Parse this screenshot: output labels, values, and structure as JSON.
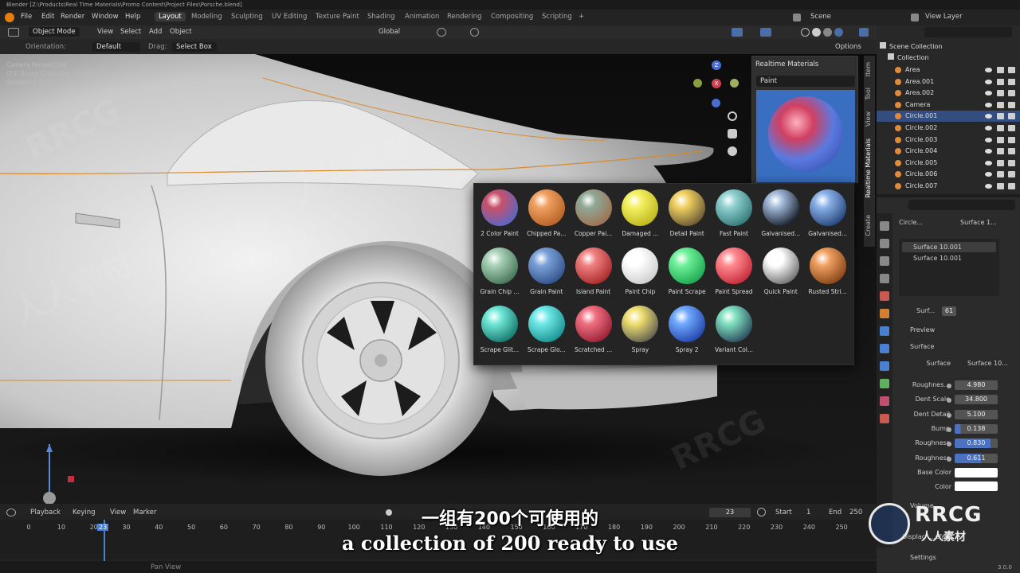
{
  "title": "Blender [Z:\\Products\\Real Time Materials\\Promo Content\\Project Files\\Porsche.blend]",
  "menus": [
    "File",
    "Edit",
    "Render",
    "Window",
    "Help"
  ],
  "workspaces": [
    "Layout",
    "Modeling",
    "Sculpting",
    "UV Editing",
    "Texture Paint",
    "Shading",
    "Animation",
    "Rendering",
    "Compositing",
    "Scripting"
  ],
  "scene": "Scene",
  "view_layer": "View Layer",
  "header": {
    "mode": "Object Mode",
    "menus": [
      "View",
      "Select",
      "Add",
      "Object"
    ],
    "transform": "Global",
    "orientation_label": "Orientation:",
    "orientation": "Default",
    "drag_label": "Drag:",
    "drag": "Select Box",
    "options": "Options"
  },
  "viewport": {
    "overlay1": "Camera Perspective",
    "overlay2": "(23) Scene Collection | Circle.001",
    "overlay3": "Rendering Done"
  },
  "rm_panel": {
    "title": "Realtime Materials",
    "category": "Paint"
  },
  "side_tabs": [
    "Item",
    "Tool",
    "View",
    "Realtime Materials",
    "Create"
  ],
  "materials": [
    {
      "label": "2 Color Paint",
      "c1": "#c9506a",
      "c2": "#4a6ad0"
    },
    {
      "label": "Chipped Pa...",
      "c1": "#f0a060",
      "c2": "#b05a20"
    },
    {
      "label": "Copper Pai...",
      "c1": "#8fa896",
      "c2": "#a06a4a"
    },
    {
      "label": "Damaged ...",
      "c1": "#f4f060",
      "c2": "#b8b018"
    },
    {
      "label": "Detail Paint",
      "c1": "#f0d060",
      "c2": "#5a4a30"
    },
    {
      "label": "Fast Paint",
      "c1": "#8fd0d0",
      "c2": "#2a7070"
    },
    {
      "label": "Galvanised...",
      "c1": "#a0b8d8",
      "c2": "#0a0f1a"
    },
    {
      "label": "Galvanised...",
      "c1": "#8ab0e8",
      "c2": "#1a3a70"
    },
    {
      "label": "Grain Chip ...",
      "c1": "#a8d0b8",
      "c2": "#3a6a4a"
    },
    {
      "label": "Grain Paint",
      "c1": "#7aa0d8",
      "c2": "#2a4a80"
    },
    {
      "label": "Island Paint",
      "c1": "#f08080",
      "c2": "#a02020"
    },
    {
      "label": "Paint Chip",
      "c1": "#ffffff",
      "c2": "#c8c8c8"
    },
    {
      "label": "Paint Scrape",
      "c1": "#6ff09a",
      "c2": "#14a048"
    },
    {
      "label": "Paint Spread",
      "c1": "#ff8a90",
      "c2": "#c02030"
    },
    {
      "label": "Quick Paint",
      "c1": "#ffffff",
      "c2": "#606060"
    },
    {
      "label": "Rusted Stri...",
      "c1": "#f0a060",
      "c2": "#7a3a10"
    },
    {
      "label": "Scrape Glit...",
      "c1": "#70e8d8",
      "c2": "#0a6a60"
    },
    {
      "label": "Scrape Glo...",
      "c1": "#70e8e8",
      "c2": "#108888"
    },
    {
      "label": "Scratched ...",
      "c1": "#f07080",
      "c2": "#901830"
    },
    {
      "label": "Spray",
      "c1": "#f0e070",
      "c2": "#505050"
    },
    {
      "label": "Spray 2",
      "c1": "#70a8ff",
      "c2": "#1a3aa0"
    },
    {
      "label": "Variant Col...",
      "c1": "#80e0c0",
      "c2": "#203a50"
    }
  ],
  "outliner": {
    "scene_collection": "Scene Collection",
    "collection": "Collection",
    "items": [
      "Area",
      "Area.001",
      "Area.002",
      "Camera",
      "Circle.001",
      "Circle.002",
      "Circle.003",
      "Circle.004",
      "Circle.005",
      "Circle.006",
      "Circle.007"
    ],
    "selected_index": 4
  },
  "properties": {
    "breadcrumb_obj": "Circle...",
    "breadcrumb_mat": "Surface 1...",
    "slots": [
      "Surface 10.001",
      "Surface 10.001"
    ],
    "mat_name": "Surf...",
    "mat_users": "61",
    "preview": "Preview",
    "surface_section": "Surface",
    "surface_label": "Surface",
    "surface_value": "Surface 10...",
    "fields": [
      {
        "label": "Roughnes...",
        "value": "4.980"
      },
      {
        "label": "Dent Scale",
        "value": "34.800"
      },
      {
        "label": "Dent Detail",
        "value": "5.100"
      },
      {
        "label": "Bump",
        "value": "0.138",
        "fill": 0.14
      },
      {
        "label": "Roughness",
        "value": "0.830",
        "fill": 0.83
      },
      {
        "label": "Roughness",
        "value": "0.611",
        "fill": 0.61
      }
    ],
    "base_color_label": "Base Color",
    "color_label": "Color",
    "volume": "Volume",
    "displacement_label": "Displac",
    "displacement_value": "...efa...",
    "settings": "Settings"
  },
  "timeline": {
    "menus": [
      "Playback",
      "Keying",
      "View",
      "Marker"
    ],
    "current_frame": "23",
    "start_label": "Start",
    "start": "1",
    "end_label": "End",
    "end": "250",
    "ticks": [
      "0",
      "10",
      "20",
      "30",
      "40",
      "50",
      "60",
      "70",
      "80",
      "90",
      "100",
      "110",
      "120",
      "130",
      "140",
      "150",
      "160",
      "170",
      "180",
      "190",
      "200",
      "210",
      "220",
      "230",
      "240",
      "250"
    ]
  },
  "status": {
    "pan": "Pan View",
    "version": "3.0.0"
  },
  "subtitle_cn": "一组有200个可使用的",
  "subtitle_en": "a collection of 200 ready to use",
  "watermarks": [
    "RRCG",
    "人人素材"
  ]
}
